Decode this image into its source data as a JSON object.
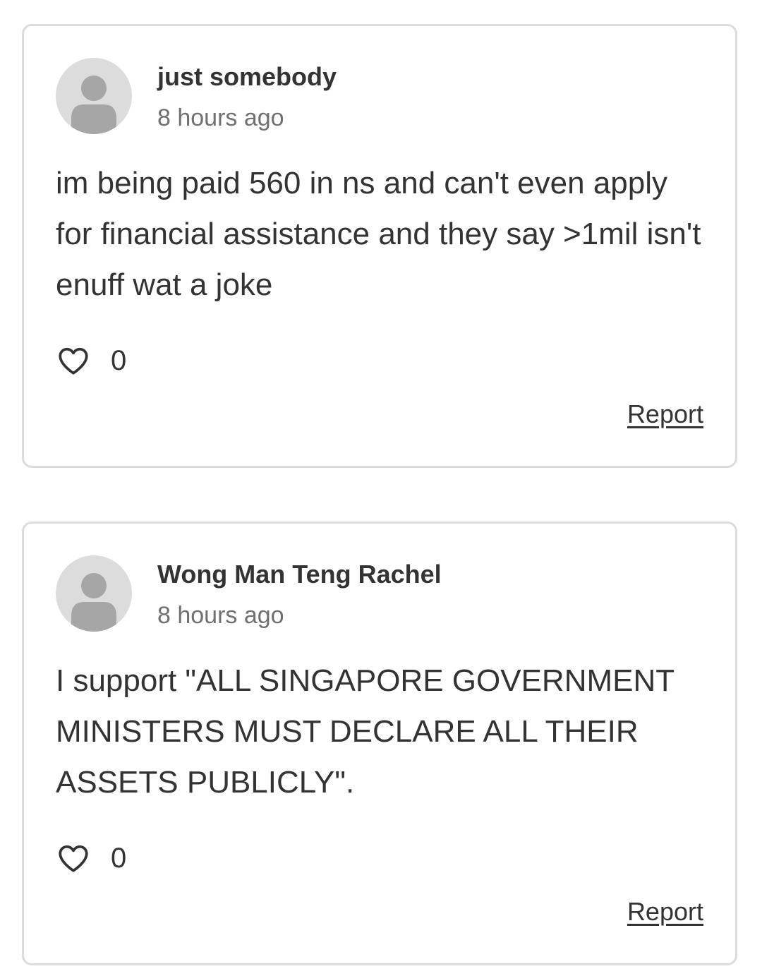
{
  "comments": [
    {
      "author": "just somebody",
      "timestamp": "8 hours ago",
      "body": "im being paid 560 in ns and can't even apply for financial assistance and they say >1mil isn't enuff wat a joke",
      "like_count": "0",
      "like_icon": "heart-outline-icon",
      "avatar_icon": "default-user-icon",
      "report_label": "Report"
    },
    {
      "author": "Wong Man Teng Rachel",
      "timestamp": "8 hours ago",
      "body": "I support \"ALL SINGAPORE GOVERNMENT MINISTERS MUST DECLARE ALL THEIR ASSETS PUBLICLY\".",
      "like_count": "0",
      "like_icon": "heart-outline-icon",
      "avatar_icon": "default-user-icon",
      "report_label": "Report"
    }
  ],
  "colors": {
    "card_border": "#dcdcdc",
    "avatar_bg": "#dcdcdc",
    "avatar_figure": "#a6a6a6",
    "text_primary": "#333333",
    "text_secondary": "#707070"
  }
}
